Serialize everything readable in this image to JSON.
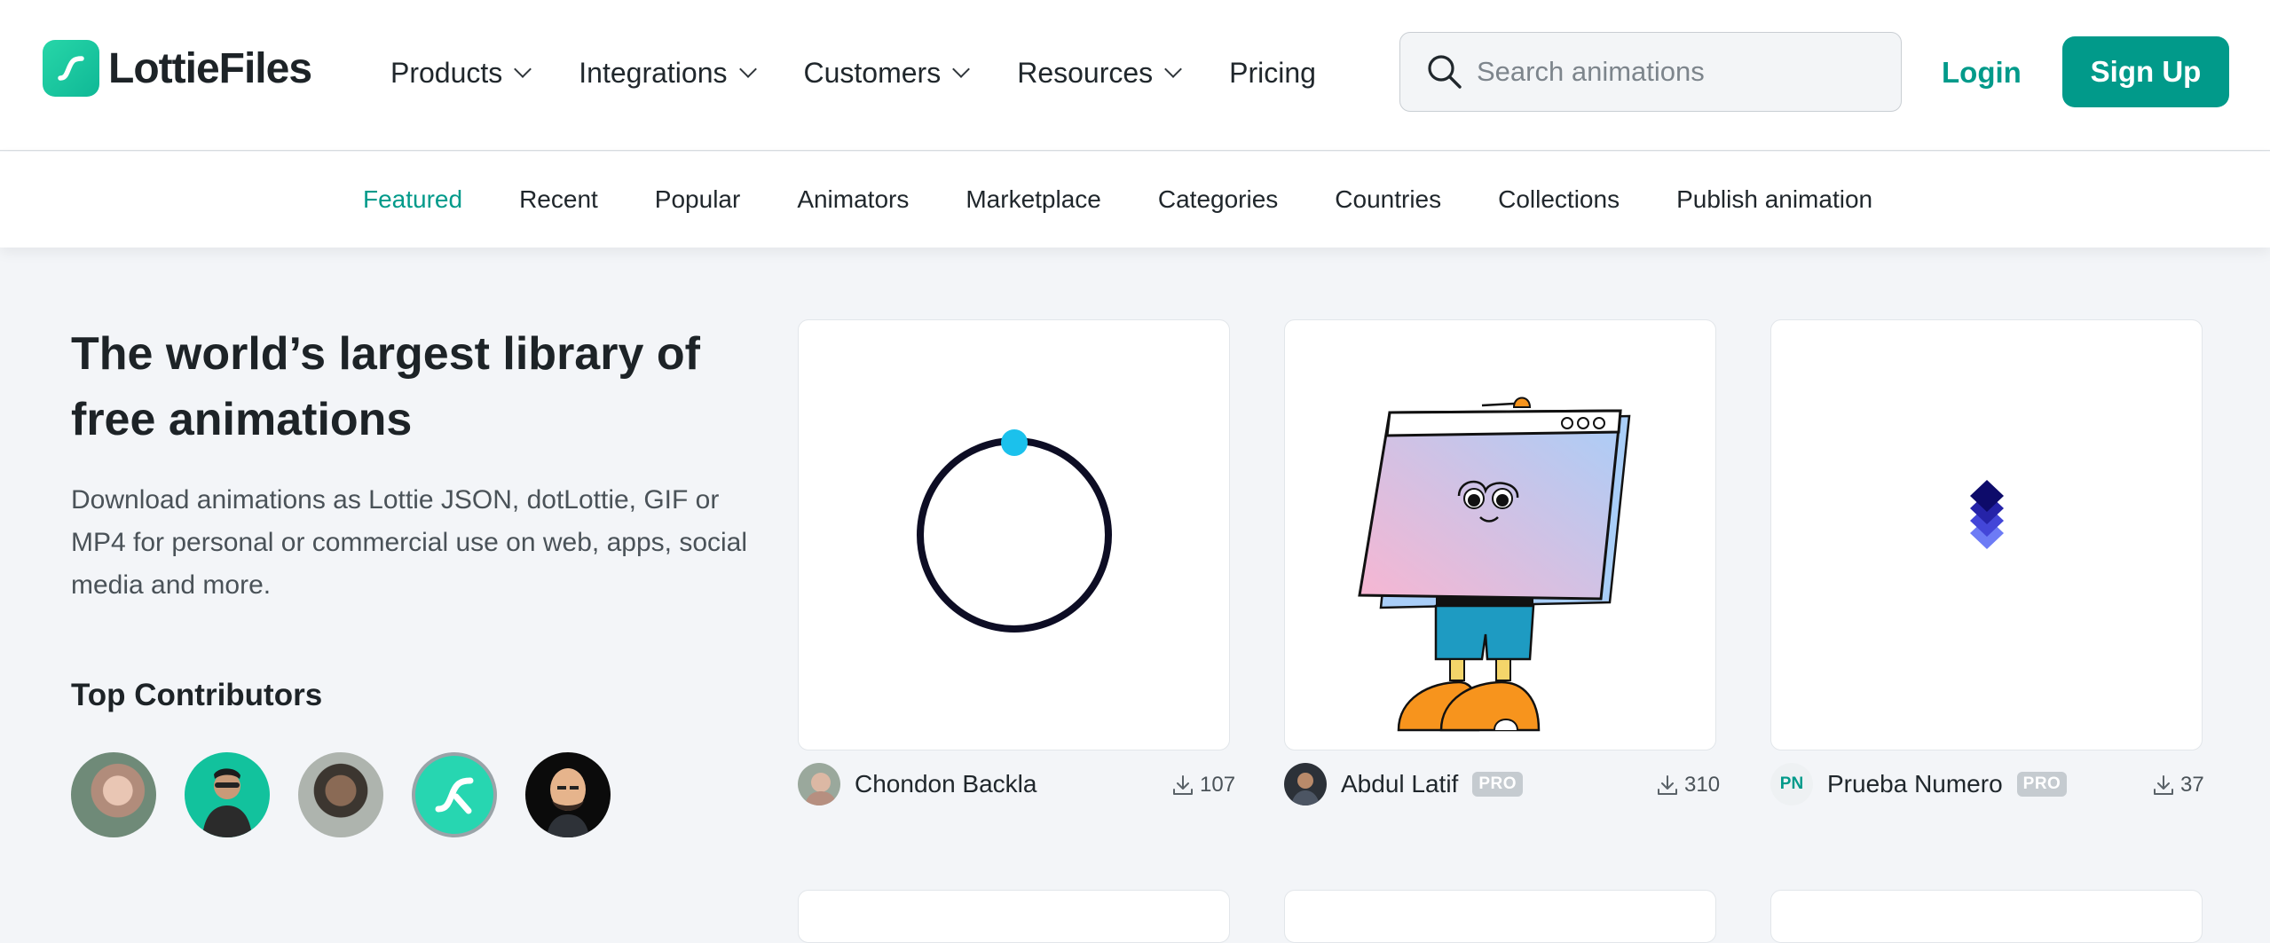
{
  "brand": {
    "name": "LottieFiles"
  },
  "nav": {
    "items": [
      {
        "label": "Products",
        "has_dropdown": true
      },
      {
        "label": "Integrations",
        "has_dropdown": true
      },
      {
        "label": "Customers",
        "has_dropdown": true
      },
      {
        "label": "Resources",
        "has_dropdown": true
      },
      {
        "label": "Pricing",
        "has_dropdown": false
      }
    ]
  },
  "search": {
    "placeholder": "Search animations",
    "icon": "search-icon"
  },
  "auth": {
    "login_label": "Login",
    "signup_label": "Sign Up"
  },
  "subnav": {
    "items": [
      {
        "label": "Featured",
        "active": true
      },
      {
        "label": "Recent"
      },
      {
        "label": "Popular"
      },
      {
        "label": "Animators"
      },
      {
        "label": "Marketplace"
      },
      {
        "label": "Categories"
      },
      {
        "label": "Countries"
      },
      {
        "label": "Collections"
      },
      {
        "label": "Publish animation"
      }
    ]
  },
  "hero": {
    "title": "The world’s largest library of free animations",
    "description": "Download animations as Lottie JSON, dotLottie, GIF or MP4 for personal or commercial use on web, apps, social media and more."
  },
  "contributors": {
    "title": "Top Contributors",
    "count": 5
  },
  "animations": [
    {
      "author": "Chondon Backla",
      "pro": false,
      "downloads": "107"
    },
    {
      "author": "Abdul Latif",
      "pro": true,
      "pro_label": "PRO",
      "downloads": "310"
    },
    {
      "author": "Prueba Numero",
      "author_initials": "PN",
      "pro": true,
      "pro_label": "PRO",
      "downloads": "37"
    }
  ],
  "colors": {
    "accent": "#019a8a",
    "brand_green": "#13c79f",
    "pro_badge": "#c5cbd0"
  }
}
